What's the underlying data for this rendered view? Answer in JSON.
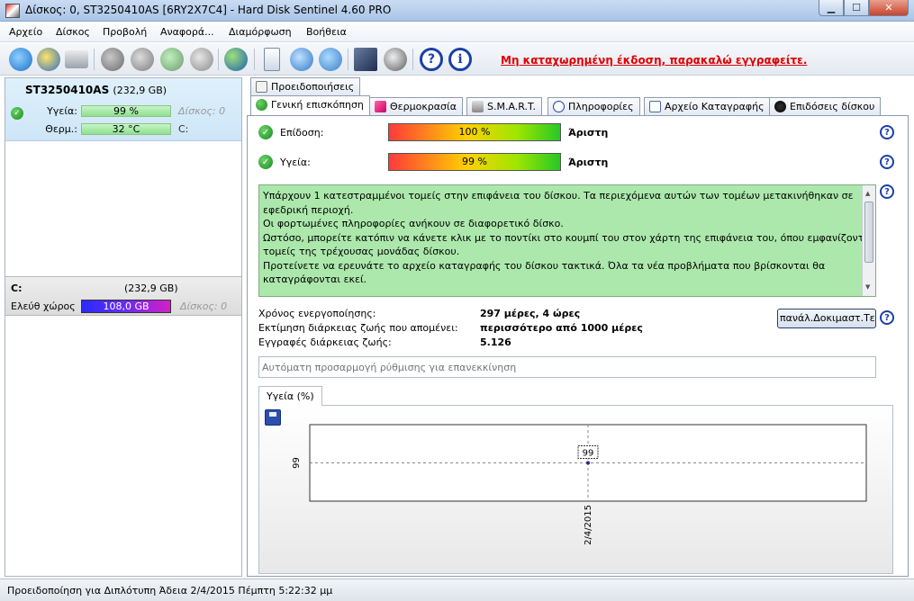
{
  "window": {
    "title": "Δίσκος: 0, ST3250410AS [6RY2X7C4]  -  Hard Disk Sentinel 4.60 PRO",
    "btn_min": "▁",
    "btn_max": "☐",
    "btn_close": "✕"
  },
  "menu": [
    "Αρχείο",
    "Δίσκος",
    "Προβολή",
    "Αναφορά...",
    "Διαμόρφωση",
    "Βοήθεια"
  ],
  "toolbar": {
    "register_text": "Μη καταχωρημένη έκδοση, παρακαλώ εγγραφείτε.",
    "icons": [
      "refresh-icon",
      "warning-icon",
      "disk-icon",
      "disk-grey-icon",
      "disk-check-icon",
      "disk-check2-icon",
      "wrench-icon",
      "globe-icon",
      "report-icon",
      "sync-icon",
      "network-icon",
      "chart-icon",
      "speaker-icon",
      "help-icon",
      "info-icon"
    ]
  },
  "left": {
    "disk_name": "ST3250410AS",
    "disk_size": "(232,9 GB)",
    "health_label": "Υγεία:",
    "health_value": "99 %",
    "health_disk_label": "Δίσκος: 0",
    "temp_label": "Θερμ.:",
    "temp_value": "32 °C",
    "temp_drive": "C:",
    "volume_letter": "C:",
    "volume_size": "(232,9 GB)",
    "free_label": "Ελεύθ χώρος",
    "free_value": "108,0 GB",
    "free_disk_label": "Δίσκος: 0"
  },
  "tabs": {
    "top": "Προειδοποιήσεις",
    "row": [
      "Γενική επισκόπηση",
      "Θερμοκρασία",
      "S.M.A.R.T.",
      "Πληροφορίες",
      "Αρχείο Καταγραφής",
      "Επιδόσεις δίσκου"
    ]
  },
  "overview": {
    "performance_label": "Επίδοση:",
    "performance_value": "100 %",
    "performance_status": "Άριστη",
    "health_label": "Υγεία:",
    "health_value": "99 %",
    "health_status": "Άριστη",
    "message_lines": [
      "Υπάρχουν 1 κατεστραμμένοι τομείς στην επιφάνεια του δίσκου. Τα περιεχόμενα αυτών των τομέων μετακινήθηκαν σε",
      "εφεδρική περιοχή.",
      "Οι φορτωμένες πληροφορίες ανήκουν σε διαφορετικό δίσκο.",
      "Ωστόσο, μπορείτε κατόπιν να κάνετε κλικ με το ποντίκι στο κουμπί του  στον  χάρτη της επιφάνεια του, όπου εμφανίζονται οι",
      "τομείς της τρέχουσας μονάδας δίσκου.",
      "Προτείνετε να ερευνάτε το αρχείο καταγραφής του δίσκου τακτικά. Όλα τα νέα προβλήματα που βρίσκονται θα",
      "καταγράφονται εκεί."
    ],
    "uptime_label": "Χρόνος ενεργοποίησης:",
    "uptime_value": "297 μέρες, 4 ώρες",
    "lifetime_label": "Εκτίμηση διάρκειας ζωής που απομένει:",
    "lifetime_value": "περισσότερο από 1000 μέρες",
    "records_label": "Εγγραφές διάρκειας ζωής:",
    "records_value": "5.126",
    "test_button": "πανάλ.Δοκιμαστ.Τεσ",
    "auto_placeholder": "Αυτόματη προσαρμογή ρύθμισης για επανεκκίνηση",
    "chart_tab": "Υγεία (%)"
  },
  "chart_data": {
    "type": "line",
    "x": [
      "2/4/2015"
    ],
    "series": [
      {
        "values": [
          99
        ]
      }
    ],
    "ytick": "99",
    "point_label": "99",
    "ylim": [
      98,
      100
    ]
  },
  "statusbar": {
    "text": "Προειδοποίηση για Διπλότυπη  Άδεια 2/4/2015 Πέμπτη 5:22:32 μμ"
  },
  "colors": {
    "register": "#e00000",
    "msg_bg": "#ace8ac",
    "free_bar_start": "#2a2aff",
    "free_bar_end": "#d61fc3"
  }
}
